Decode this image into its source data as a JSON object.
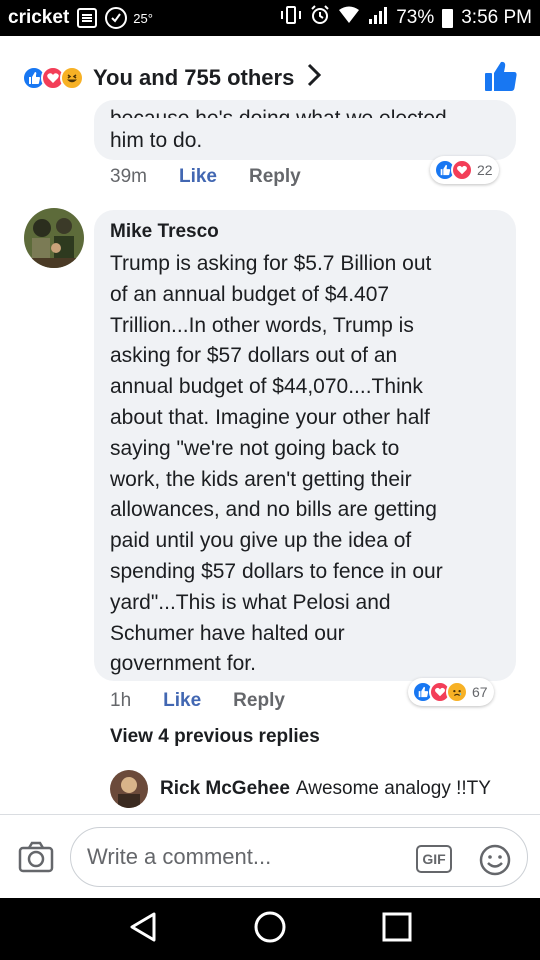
{
  "status_bar": {
    "carrier": "cricket",
    "temperature": "25°",
    "battery": "73%",
    "time": "3:56 PM"
  },
  "header": {
    "reactors_text": "You and 755 others",
    "reactions": [
      "like",
      "love",
      "haha"
    ]
  },
  "comments": [
    {
      "cut_text": "because he's doing what we elected",
      "text": "him to do.",
      "time": "39m",
      "like_label": "Like",
      "reply_label": "Reply",
      "reactions": [
        "like",
        "love"
      ],
      "reaction_count": "22"
    },
    {
      "author": "Mike Tresco",
      "text_lines": [
        "Trump is asking for $5.7 Billion out",
        "of an annual budget of $4.407",
        "Trillion...In other words, Trump is",
        "asking for $57 dollars out of an",
        "annual budget of $44,070....Think",
        "about that. Imagine your other half",
        "saying \"we're not going back to",
        "work, the kids aren't getting their",
        "allowances, and no bills are getting",
        "paid until you give up the idea of",
        "spending $57 dollars to fence in our",
        "yard\"...This is what Pelosi and",
        "Schumer have halted our",
        "government for."
      ],
      "time": "1h",
      "like_label": "Like",
      "reply_label": "Reply",
      "reactions": [
        "like",
        "love",
        "sad"
      ],
      "reaction_count": "67"
    }
  ],
  "view_replies": "View 4 previous replies",
  "latest_reply": {
    "author": "Rick McGehee",
    "text": "Awesome analogy !!TY"
  },
  "composer": {
    "placeholder": "Write a comment...",
    "gif_label": "GIF"
  },
  "colors": {
    "like_blue": "#1877f2",
    "love_red": "#f33e58",
    "haha_yellow": "#f7b125",
    "bubble_gray": "#f0f2f5",
    "link_blue": "#4267b2"
  }
}
